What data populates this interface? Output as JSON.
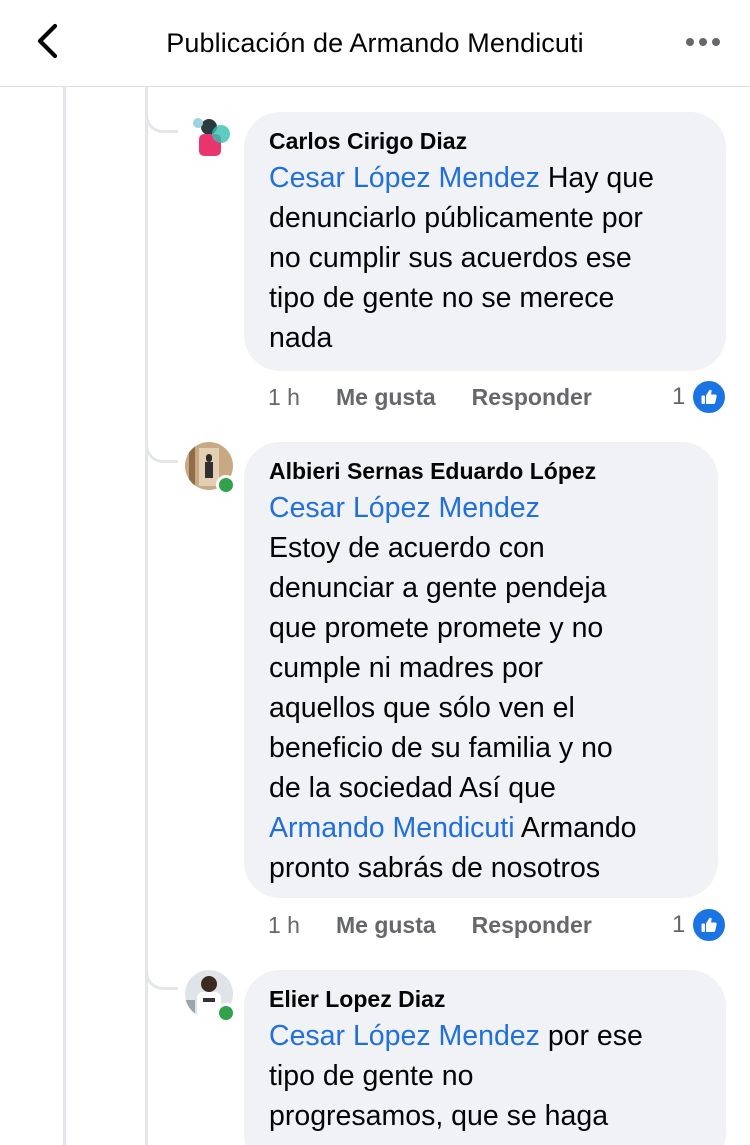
{
  "header": {
    "title": "Publicación de Armando Mendicuti"
  },
  "comments": [
    {
      "author": "Carlos Cirigo Diaz",
      "mention": "Cesar López Mendez",
      "text_lines": [
        " Hay que",
        "denunciarlo públicamente por",
        "no cumplir sus acuerdos ese",
        "tipo de gente no se merece",
        "nada"
      ],
      "time": "1 h",
      "like_label": "Me gusta",
      "reply_label": "Responder",
      "reaction_count": "1",
      "online": false
    },
    {
      "author": "Albieri Sernas Eduardo López",
      "mention": "Cesar López Mendez",
      "text_lines": [
        "Estoy de acuerdo con",
        "denunciar a gente pendeja",
        "que promete promete y no",
        "cumple ni madres por",
        "aquellos que sólo ven el",
        "beneficio de su familia y no",
        "de la sociedad Así que"
      ],
      "mention2": "Armando Mendicuti",
      "text_after_mention2": " Armando",
      "final_line": "pronto sabrás de nosotros",
      "time": "1 h",
      "like_label": "Me gusta",
      "reply_label": "Responder",
      "reaction_count": "1",
      "online": true
    },
    {
      "author": "Elier Lopez Diaz",
      "mention": "Cesar López Mendez",
      "text_lines": [
        " por ese",
        "tipo de gente no",
        "progresamos, que se haga"
      ],
      "online": true
    }
  ],
  "icons": {
    "back": "chevron-left-icon",
    "more": "more-horizontal-icon",
    "like": "thumbs-up-icon"
  },
  "colors": {
    "mention": "#216fdb",
    "like_badge": "#1b74e4",
    "bubble": "#f0f2f5",
    "online": "#31a24c"
  }
}
